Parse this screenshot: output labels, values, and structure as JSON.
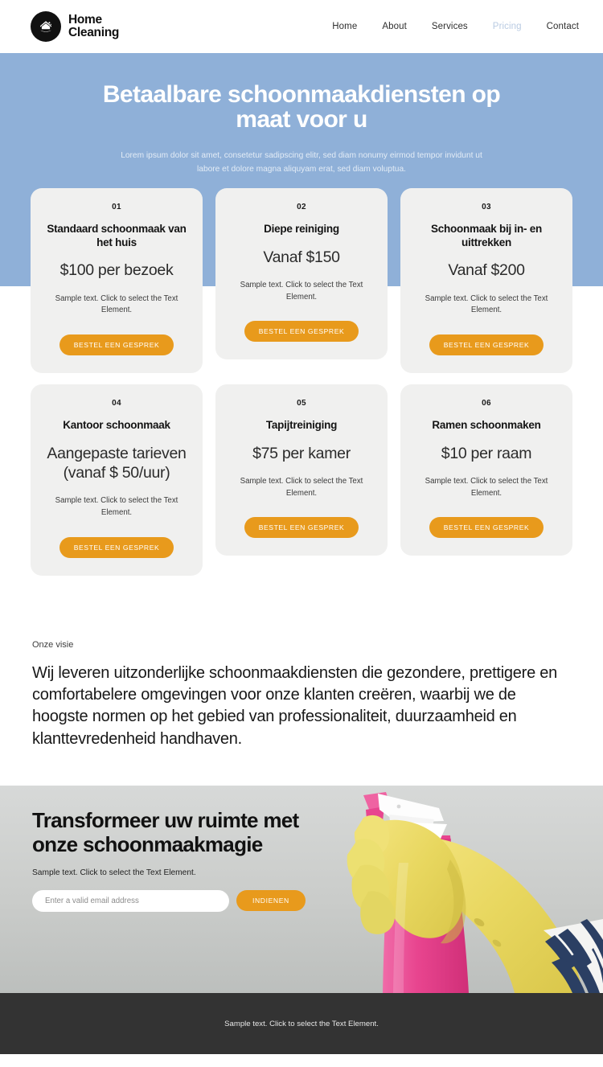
{
  "header": {
    "brand": {
      "name": "Home\nCleaning",
      "icon": "house-in-circle-logo"
    },
    "nav": [
      {
        "label": "Home",
        "active": false
      },
      {
        "label": "About",
        "active": false
      },
      {
        "label": "Services",
        "active": false
      },
      {
        "label": "Pricing",
        "active": true
      },
      {
        "label": "Contact",
        "active": false
      }
    ]
  },
  "hero": {
    "title": "Betaalbare schoonmaakdiensten op maat voor u",
    "subtitle": "Lorem ipsum dolor sit amet, consetetur sadipscing elitr, sed diam nonumy eirmod tempor invidunt ut labore et dolore magna aliquyam erat, sed diam voluptua.",
    "background_color": "#8fb0d8"
  },
  "pricing": {
    "sample_text": "Sample text. Click to select the Text Element.",
    "cta_label": "BESTEL EEN GESPREK",
    "cards": [
      {
        "num": "01",
        "title": "Standaard schoonmaak van het huis",
        "price": "$100 per bezoek",
        "desc": "Sample text. Click to select the Text Element.",
        "button": "BESTEL EEN GESPREK"
      },
      {
        "num": "02",
        "title": "Diepe reiniging",
        "price": "Vanaf $150",
        "desc": "Sample text. Click to select the Text Element.",
        "button": "BESTEL EEN GESPREK"
      },
      {
        "num": "03",
        "title": "Schoonmaak bij in- en uittrekken",
        "price": "Vanaf $200",
        "desc": "Sample text. Click to select the Text Element.",
        "button": "BESTEL EEN GESPREK"
      },
      {
        "num": "04",
        "title": "Kantoor schoonmaak",
        "price": "Aangepaste tarieven (vanaf $ 50/uur)",
        "desc": "Sample text. Click to select the Text Element.",
        "button": "BESTEL EEN GESPREK"
      },
      {
        "num": "05",
        "title": "Tapijtreiniging",
        "price": "$75 per kamer",
        "desc": "Sample text. Click to select the Text Element.",
        "button": "BESTEL EEN GESPREK"
      },
      {
        "num": "06",
        "title": "Ramen schoonmaken",
        "price": "$10 per raam",
        "desc": "Sample text. Click to select the Text Element.",
        "button": "BESTEL EEN GESPREK"
      }
    ]
  },
  "vision": {
    "eyebrow": "Onze visie",
    "body": "Wij leveren uitzonderlijke schoonmaakdiensten die gezondere, prettigere en comfortabelere omgevingen voor onze klanten creëren, waarbij we de hoogste normen op het gebied van professionaliteit, duurzaamheid en klanttevredenheid handhaven."
  },
  "cta": {
    "title": "Transformeer uw ruimte met onze schoonmaakmagie",
    "subtitle": "Sample text. Click to select the Text Element.",
    "email_placeholder": "Enter a valid email address",
    "email_value": "",
    "submit_label": "INDIENEN",
    "image_alt": "yellow-gloved-hand-holding-pink-spray-bottle"
  },
  "footer": {
    "text": "Sample text. Click to select the Text Element.",
    "background_color": "#333333"
  },
  "theme": {
    "accent_orange": "#e89a1c",
    "hero_blue": "#8fb0d8",
    "card_gray": "#f0f0ef",
    "footer_dark": "#333333"
  }
}
